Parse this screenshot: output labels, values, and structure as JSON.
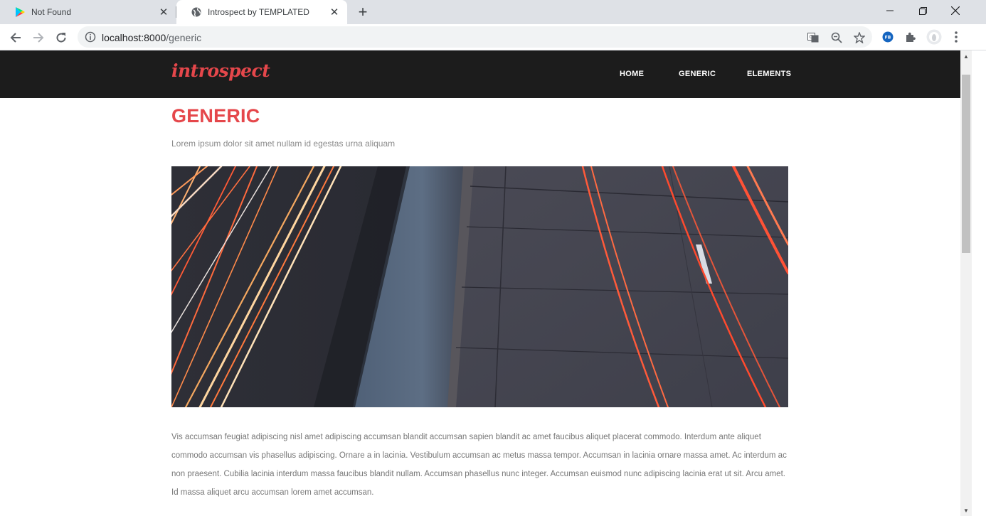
{
  "browser": {
    "tabs": [
      {
        "title": "Not Found",
        "favicon": "play-store-icon"
      },
      {
        "title": "Introspect by TEMPLATED",
        "favicon": "globe-icon"
      }
    ],
    "url_host": "localhost:8000",
    "url_path": "/generic",
    "extension_badge": "FB"
  },
  "site": {
    "logo": "introspect",
    "nav": [
      "HOME",
      "GENERIC",
      "ELEMENTS"
    ]
  },
  "page": {
    "title": "GENERIC",
    "subtitle": "Lorem ipsum dolor sit amet nullam id egestas urna aliquam",
    "hero_alt": "highway-light-trails-image",
    "paragraph": "Vis accumsan feugiat adipiscing nisl amet adipiscing accumsan blandit accumsan sapien blandit ac amet faucibus aliquet placerat commodo. Interdum ante aliquet commodo accumsan vis phasellus adipiscing. Ornare a in lacinia. Vestibulum accumsan ac metus massa tempor. Accumsan in lacinia ornare massa amet. Ac interdum ac non praesent. Cubilia lacinia interdum massa faucibus blandit nullam. Accumsan phasellus nunc integer. Accumsan euismod nunc adipiscing lacinia erat ut sit. Arcu amet. Id massa aliquet arcu accumsan lorem amet accumsan."
  },
  "colors": {
    "accent": "#e5474b",
    "header_bg": "#1c1c1c",
    "text": "#777777"
  }
}
